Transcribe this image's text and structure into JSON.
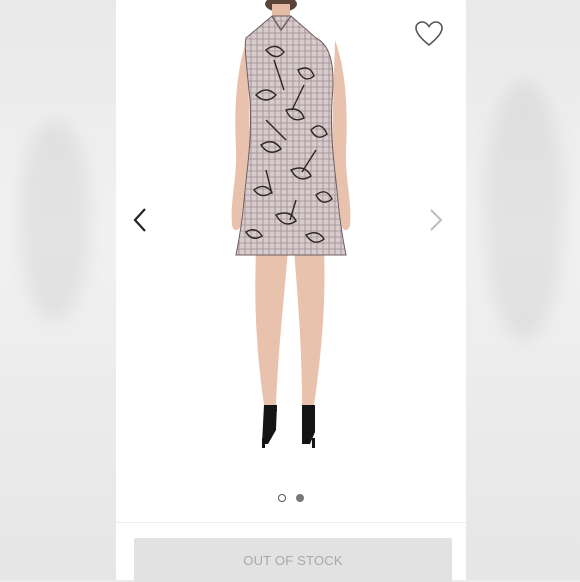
{
  "gallery": {
    "product_image": "floral-plaid-sleeveless-dress-back-view",
    "total_images": 2,
    "active_index": 2
  },
  "icons": {
    "favorite": "heart-outline-icon",
    "previous": "chevron-left-icon",
    "next": "chevron-right-icon"
  },
  "actions": {
    "primary_button_label": "OUT OF STOCK"
  },
  "colors": {
    "card_background": "#ffffff",
    "button_background": "#e2e2e2",
    "button_text": "#a8a8a8",
    "dress_base": "#d8cbcc",
    "dress_pattern": "#2b2426",
    "skin": "#e8c2ad"
  }
}
